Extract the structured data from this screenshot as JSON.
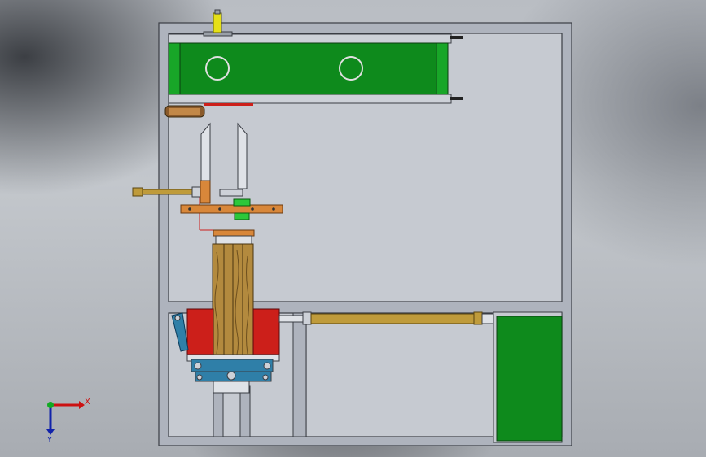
{
  "viewport": {
    "background": "gradient-gray",
    "model": "machine-assembly-front-view"
  },
  "colors": {
    "frame": "#b7bcc6",
    "frame_edge": "#3a3d44",
    "green_part": "#0e8a1c",
    "red_part": "#cc1f1a",
    "blue_part": "#2f7fa8",
    "brass_rod": "#bf9b3b",
    "orange_bracket": "#d8873a",
    "wood_block": "#b38a3e",
    "yellow_cap": "#e5e018"
  },
  "triad": {
    "x_label": "X",
    "y_label": "Y",
    "x_color": "#cc1111",
    "y_color": "#1122aa",
    "origin_color": "#11aa22"
  }
}
